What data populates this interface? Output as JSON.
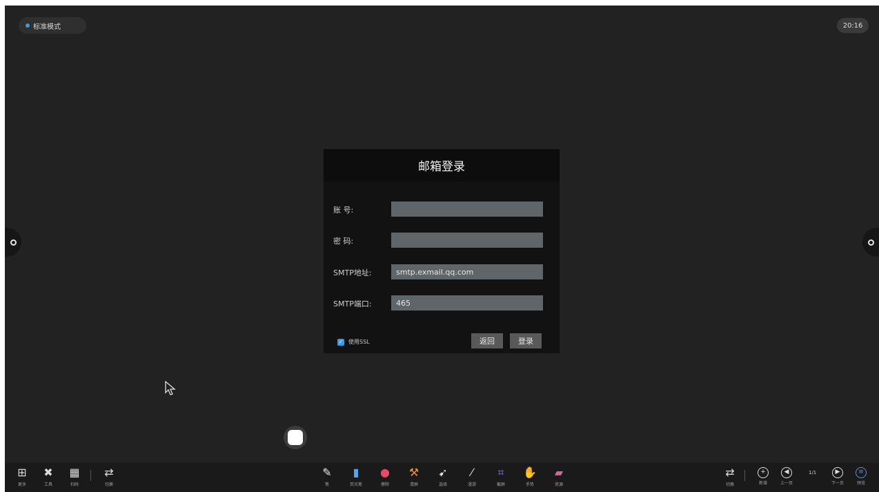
{
  "status_bar": {
    "mode_label": "标准模式",
    "clock": "20:16"
  },
  "dialog": {
    "title": "邮箱登录",
    "fields": {
      "account": {
        "label": "账 号:",
        "value": ""
      },
      "password": {
        "label": "密 码:",
        "value": ""
      },
      "smtp_address": {
        "label": "SMTP地址:",
        "value": "smtp.exmail.qq.com"
      },
      "smtp_port": {
        "label": "SMTP端口:",
        "value": "465"
      }
    },
    "ssl_label": "使用SSL",
    "ssl_checked": true,
    "back_button": "返回",
    "login_button": "登录"
  },
  "toolbar": {
    "left_tools": [
      {
        "icon": "apps-grid-icon",
        "label": "更多"
      },
      {
        "icon": "tools-icon",
        "label": "工具"
      },
      {
        "icon": "qr-code-icon",
        "label": "扫码"
      },
      {
        "icon": "switch-icon",
        "label": "切换"
      }
    ],
    "center_tools": [
      {
        "icon": "pen-icon",
        "label": "笔"
      },
      {
        "icon": "highlighter-icon",
        "label": "荧光笔"
      },
      {
        "icon": "eraser-icon",
        "label": "擦除"
      },
      {
        "icon": "hammer-icon",
        "label": "清屏"
      },
      {
        "icon": "select-icon",
        "label": "选择"
      },
      {
        "icon": "brush-icon",
        "label": "漫游"
      },
      {
        "icon": "capture-icon",
        "label": "截屏"
      },
      {
        "icon": "hand-icon",
        "label": "手势"
      },
      {
        "icon": "book-icon",
        "label": "资源"
      }
    ],
    "right_tools": [
      {
        "icon": "switch-icon",
        "label": "切换"
      },
      {
        "icon": "add-page-icon",
        "label": "新增"
      },
      {
        "icon": "prev-page-icon",
        "label": "上一页"
      },
      {
        "icon": "next-page-icon",
        "label": "下一页"
      },
      {
        "icon": "page-list-icon",
        "label": "预览"
      }
    ],
    "page_counter": "1/1"
  },
  "colors": {
    "accent": "#3a9be8",
    "background": "#222222",
    "dialog": "#121212",
    "input": "#5f6568"
  }
}
